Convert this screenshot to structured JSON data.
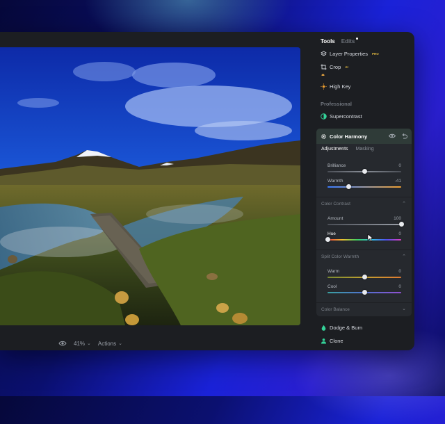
{
  "panel": {
    "tabs": [
      {
        "label": "Tools",
        "active": true
      },
      {
        "label": "Edits",
        "active": false
      }
    ],
    "tools_top": [
      {
        "label": "Layer Properties",
        "icon": "layers-icon",
        "badge": "PRO"
      },
      {
        "label": "Crop",
        "icon": "crop-icon",
        "badge": "AI"
      },
      {
        "label": "High Key",
        "icon": "sun-icon"
      }
    ],
    "professional_label": "Professional",
    "supercontrast_label": "Supercontrast",
    "card": {
      "title": "Color Harmony",
      "subtabs": [
        {
          "label": "Adjustments",
          "active": true
        },
        {
          "label": "Masking",
          "active": false
        }
      ],
      "sliders_main": [
        {
          "label": "Brilliance",
          "value": "0",
          "fraction": 0.5
        },
        {
          "label": "Warmth",
          "value": "-41",
          "fraction": 0.29
        }
      ],
      "color_contrast": {
        "label": "Color Contrast",
        "sliders": [
          {
            "label": "Amount",
            "value": "100",
            "fraction": 1.0
          },
          {
            "label": "Hue",
            "value": "0",
            "fraction": 0.0
          }
        ]
      },
      "split_color_warmth": {
        "label": "Split Color Warmth",
        "sliders": [
          {
            "label": "Warm",
            "value": "0",
            "fraction": 0.5
          },
          {
            "label": "Cool",
            "value": "0",
            "fraction": 0.5
          }
        ]
      },
      "color_balance_label": "Color Balance"
    },
    "tools_bottom": [
      {
        "label": "Dodge & Burn",
        "icon": "drop-icon"
      },
      {
        "label": "Clone",
        "icon": "person-icon"
      }
    ]
  },
  "bottombar": {
    "zoom": "41%",
    "actions": "Actions"
  },
  "colors": {
    "accent_green": "#34d399",
    "accent_yellow": "#e0b840"
  }
}
